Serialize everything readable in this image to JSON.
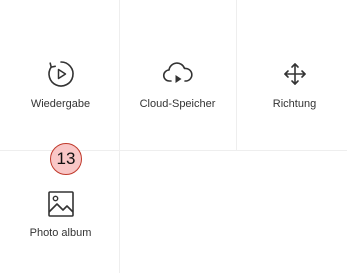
{
  "menu": {
    "items": [
      {
        "label": "Wiedergabe",
        "icon": "playback-icon"
      },
      {
        "label": "Cloud-Speicher",
        "icon": "cloud-play-icon"
      },
      {
        "label": "Richtung",
        "icon": "move-arrows-icon"
      },
      {
        "label": "Photo album",
        "icon": "photo-album-icon"
      }
    ]
  },
  "annotation": {
    "badge_number": "13",
    "badge_color": "#f9c7c7",
    "badge_border": "#c0392b"
  },
  "colors": {
    "icon": "#333333",
    "label": "#333333",
    "grid_line": "#eeeeee"
  }
}
